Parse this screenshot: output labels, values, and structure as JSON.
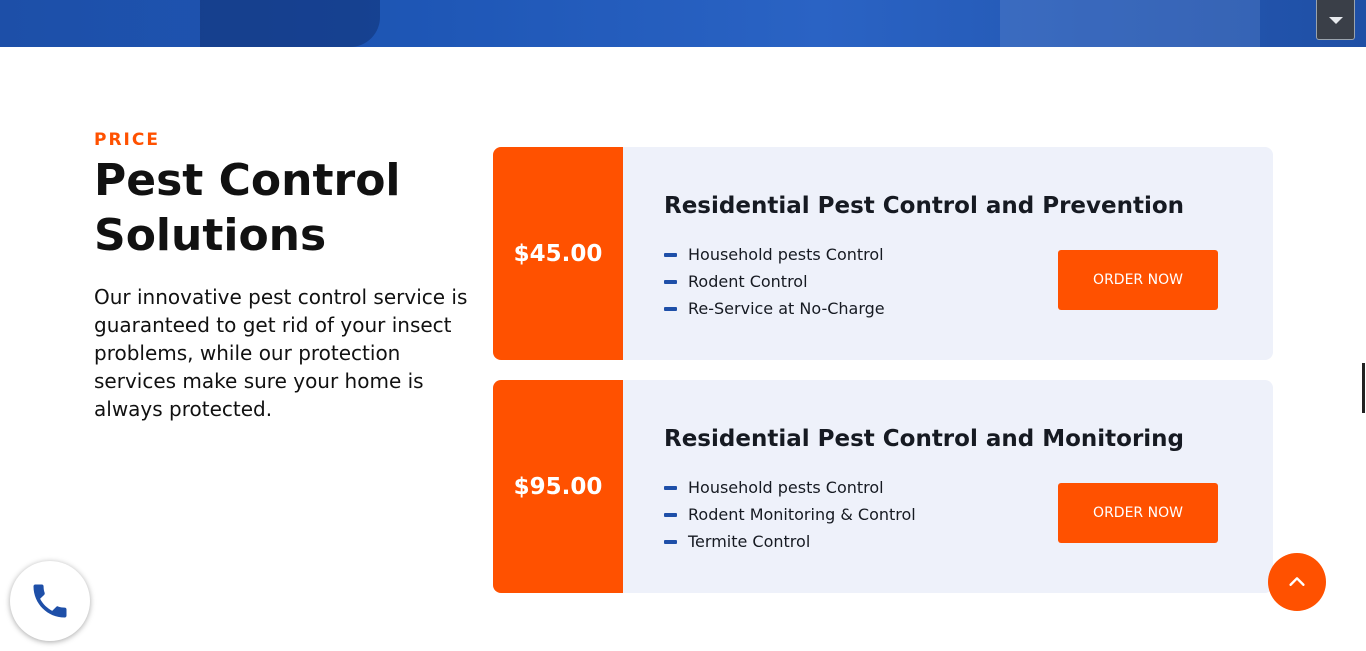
{
  "hero": {
    "dropdown_icon": "caret-down-icon"
  },
  "section": {
    "eyebrow": "PRICE",
    "title": "Pest Control Solutions",
    "description": "Our innovative pest control service is guaranteed to get rid of your insect problems, while our protection services make sure your home is always protected."
  },
  "plans": [
    {
      "price": "$45.00",
      "title": "Residential Pest Control and Prevention",
      "features": [
        "Household pests Control",
        "Rodent Control",
        "Re-Service at No-Charge"
      ],
      "button_label": "ORDER NOW"
    },
    {
      "price": "$95.00",
      "title": "Residential Pest Control and Monitoring",
      "features": [
        "Household pests Control",
        "Rodent Monitoring & Control",
        "Termite Control"
      ],
      "button_label": "ORDER NOW"
    }
  ],
  "floating": {
    "call_icon": "phone-icon",
    "top_icon": "chevron-up-icon"
  },
  "colors": {
    "accent": "#ff5100",
    "brand_blue": "#1e4fa8",
    "card_bg": "#eef1fa"
  }
}
